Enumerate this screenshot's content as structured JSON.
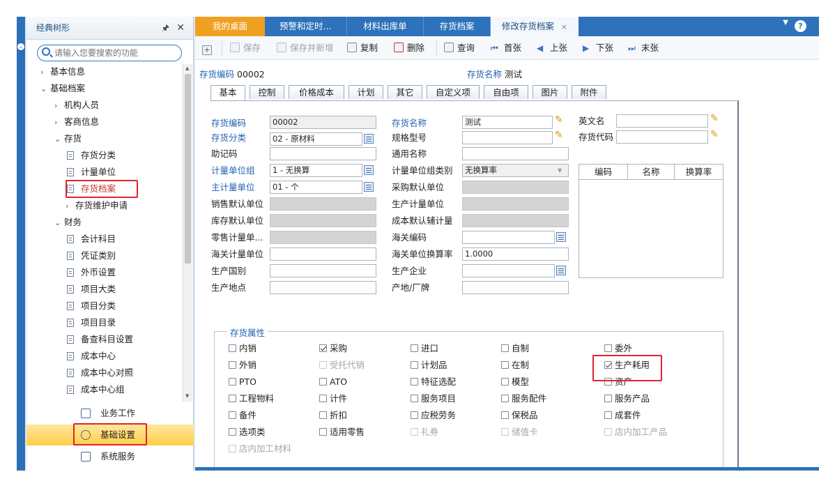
{
  "tree": {
    "title": "经典树形",
    "search_placeholder": "请输入您要搜索的功能",
    "nodes": [
      {
        "label": "基本信息",
        "arrow": "›"
      },
      {
        "label": "基础档案",
        "arrow": "⌄"
      },
      {
        "label": "机构人员",
        "arrow": "›"
      },
      {
        "label": "客商信息",
        "arrow": "›"
      },
      {
        "label": "存货",
        "arrow": "⌄"
      },
      {
        "label": "存货分类"
      },
      {
        "label": "计量单位"
      },
      {
        "label": "存货档案"
      },
      {
        "label": "存货维护申请",
        "arrow": "›"
      },
      {
        "label": "财务",
        "arrow": "⌄"
      },
      {
        "label": "会计科目"
      },
      {
        "label": "凭证类别"
      },
      {
        "label": "外币设置"
      },
      {
        "label": "项目大类"
      },
      {
        "label": "项目分类"
      },
      {
        "label": "项目目录"
      },
      {
        "label": "备查科目设置"
      },
      {
        "label": "成本中心"
      },
      {
        "label": "成本中心对照"
      },
      {
        "label": "成本中心组"
      }
    ],
    "modules": [
      "业务工作",
      "基础设置",
      "系统服务"
    ]
  },
  "tabs": [
    {
      "label": "我的桌面"
    },
    {
      "label": "预警和定时…"
    },
    {
      "label": "材料出库单"
    },
    {
      "label": "存货档案"
    },
    {
      "label": "修改存货档案",
      "close": "×"
    }
  ],
  "toolbar": [
    "保存",
    "保存并新增",
    "复制",
    "删除",
    "查询",
    "首张",
    "上张",
    "下张",
    "末张"
  ],
  "header": {
    "code_label": "存货编码",
    "code_value": "00002",
    "name_label": "存货名称",
    "name_value": "测试"
  },
  "subtabs": [
    "基本",
    "控制",
    "价格成本",
    "计划",
    "其它",
    "自定义项",
    "自由项",
    "图片",
    "附件"
  ],
  "form": {
    "col1": [
      {
        "label": "存货编码",
        "value": "00002"
      },
      {
        "label": "存货分类",
        "value": "02 - 原材料"
      },
      {
        "label": "助记码",
        "value": ""
      },
      {
        "label": "计量单位组",
        "value": "1 - 无换算"
      },
      {
        "label": "主计量单位",
        "value": "01 - 个"
      },
      {
        "label": "销售默认单位",
        "value": ""
      },
      {
        "label": "库存默认单位",
        "value": ""
      },
      {
        "label": "零售计量单...",
        "value": ""
      },
      {
        "label": "海关计量单位",
        "value": ""
      },
      {
        "label": "生产国别",
        "value": ""
      },
      {
        "label": "生产地点",
        "value": ""
      }
    ],
    "col2": [
      {
        "label": "存货名称",
        "value": "测试"
      },
      {
        "label": "规格型号",
        "value": ""
      },
      {
        "label": "通用名称",
        "value": ""
      },
      {
        "label": "计量单位组类别",
        "value": "无换算率"
      },
      {
        "label": "采购默认单位",
        "value": ""
      },
      {
        "label": "生产计量单位",
        "value": ""
      },
      {
        "label": "成本默认辅计量",
        "value": ""
      },
      {
        "label": "海关编码",
        "value": ""
      },
      {
        "label": "海关单位换算率",
        "value": "1.0000"
      },
      {
        "label": "生产企业",
        "value": ""
      },
      {
        "label": "产地/厂牌",
        "value": ""
      }
    ],
    "col3": [
      {
        "label": "英文名",
        "value": ""
      },
      {
        "label": "存货代码",
        "value": ""
      }
    ],
    "grid_headers": [
      "编码",
      "名称",
      "换算率"
    ]
  },
  "attributes": {
    "legend": "存货属性",
    "items": [
      {
        "label": "内销",
        "checked": false,
        "disabled": false
      },
      {
        "label": "采购",
        "checked": true,
        "disabled": false
      },
      {
        "label": "进口",
        "checked": false,
        "disabled": false
      },
      {
        "label": "自制",
        "checked": false,
        "disabled": false
      },
      {
        "label": "委外",
        "checked": false,
        "disabled": false
      },
      {
        "label": "外销",
        "checked": false,
        "disabled": false
      },
      {
        "label": "受托代销",
        "checked": false,
        "disabled": true
      },
      {
        "label": "计划品",
        "checked": false,
        "disabled": false
      },
      {
        "label": "在制",
        "checked": false,
        "disabled": false
      },
      {
        "label": "生产耗用",
        "checked": true,
        "disabled": false
      },
      {
        "label": "PTO",
        "checked": false,
        "disabled": false
      },
      {
        "label": "ATO",
        "checked": false,
        "disabled": false
      },
      {
        "label": "特征选配",
        "checked": false,
        "disabled": false
      },
      {
        "label": "模型",
        "checked": false,
        "disabled": false
      },
      {
        "label": "资产",
        "checked": false,
        "disabled": false
      },
      {
        "label": "工程物料",
        "checked": false,
        "disabled": false
      },
      {
        "label": "计件",
        "checked": false,
        "disabled": false
      },
      {
        "label": "服务项目",
        "checked": false,
        "disabled": false
      },
      {
        "label": "服务配件",
        "checked": false,
        "disabled": false
      },
      {
        "label": "服务产品",
        "checked": false,
        "disabled": false
      },
      {
        "label": "备件",
        "checked": false,
        "disabled": false
      },
      {
        "label": "折扣",
        "checked": false,
        "disabled": false
      },
      {
        "label": "应税劳务",
        "checked": false,
        "disabled": false
      },
      {
        "label": "保税品",
        "checked": false,
        "disabled": false
      },
      {
        "label": "成套件",
        "checked": false,
        "disabled": false
      },
      {
        "label": "选项类",
        "checked": false,
        "disabled": false
      },
      {
        "label": "适用零售",
        "checked": false,
        "disabled": false
      },
      {
        "label": "礼券",
        "checked": false,
        "disabled": true
      },
      {
        "label": "储值卡",
        "checked": false,
        "disabled": true
      },
      {
        "label": "店内加工产品",
        "checked": false,
        "disabled": true
      },
      {
        "label": "店内加工材料",
        "checked": false,
        "disabled": true
      }
    ]
  },
  "colors": {
    "accent": "#2d72ba",
    "highlight": "#e0242a",
    "active_tab": "#f0a020"
  }
}
